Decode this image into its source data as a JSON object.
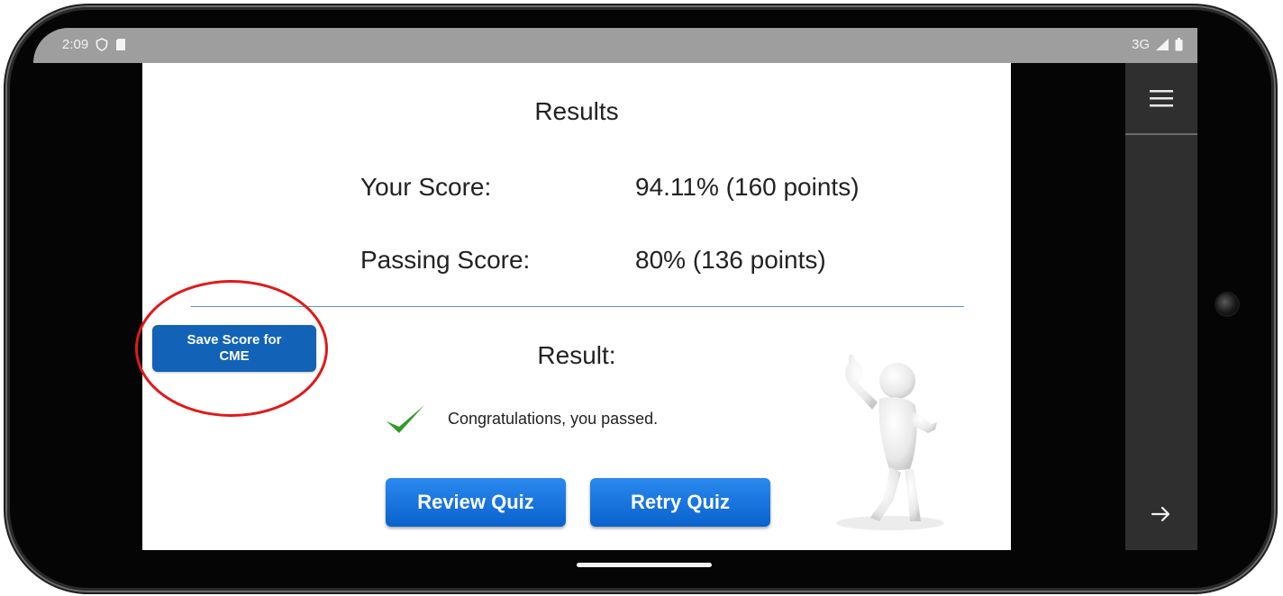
{
  "statusbar": {
    "time": "2:09",
    "network": "3G"
  },
  "results": {
    "title": "Results",
    "your_score_label": "Your Score:",
    "your_score_value": "94.11% (160 points)",
    "passing_score_label": "Passing Score:",
    "passing_score_value": "80% (136 points)",
    "result_label": "Result:",
    "message": "Congratulations, you passed."
  },
  "buttons": {
    "save_score_line1": "Save Score for",
    "save_score_line2": "CME",
    "review_quiz": "Review Quiz",
    "retry_quiz": "Retry Quiz"
  },
  "icons": {
    "menu": "hamburger-menu-icon",
    "next": "arrow-right-icon",
    "check": "checkmark-icon"
  },
  "colors": {
    "primary_button": "#1263b7",
    "quiz_button": "#1a76e3",
    "check": "#2f9a2a",
    "annotation_ring": "#e11919"
  }
}
